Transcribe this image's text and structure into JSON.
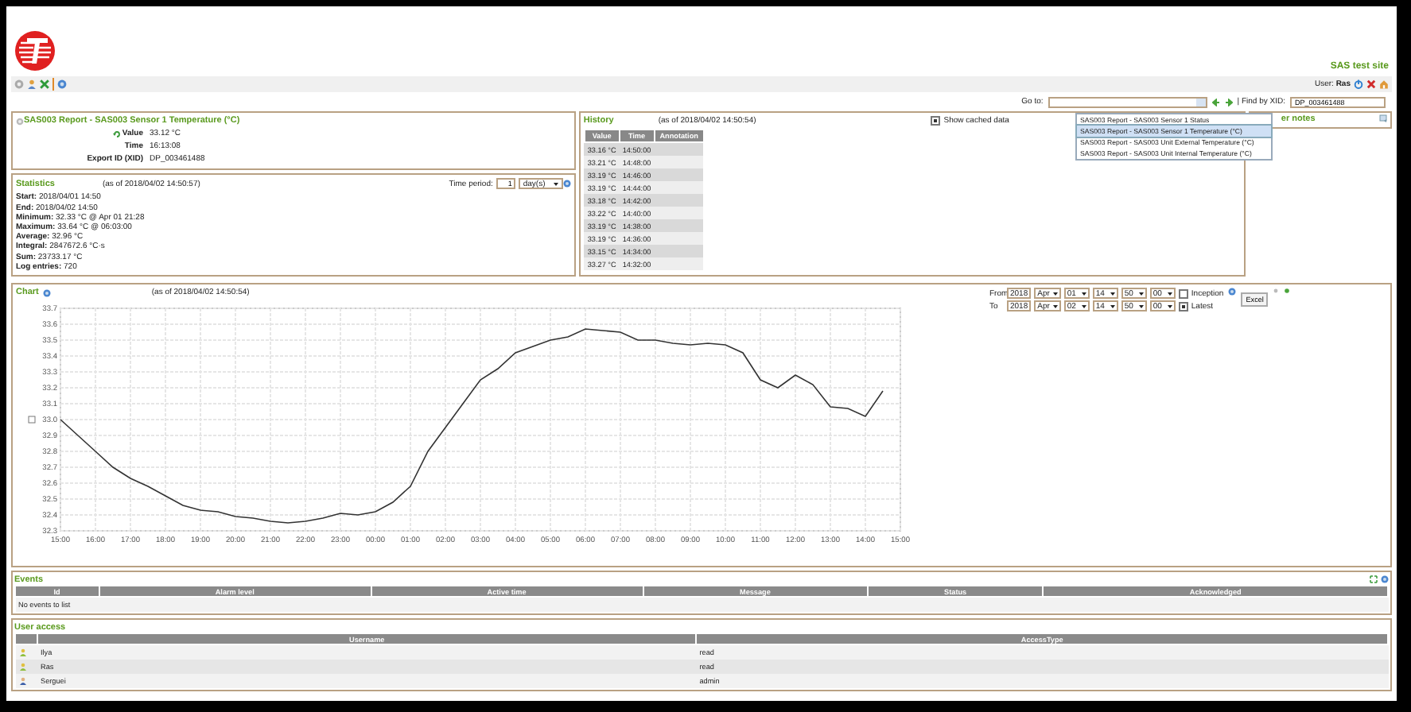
{
  "header": {
    "site_name": "SAS test site",
    "user_label": "User:",
    "user_name": "Ras"
  },
  "goto": {
    "label": "Go to:",
    "find_label": "| Find by XID:",
    "xid_value": "DP_003461488",
    "options": [
      {
        "label": "SAS003 Report - SAS003 Sensor 1 Status",
        "selected": false
      },
      {
        "label": "SAS003 Report - SAS003 Sensor 1 Temperature (°C)",
        "selected": true
      },
      {
        "label": "SAS003 Report - SAS003 Unit External Temperature (°C)",
        "selected": false
      },
      {
        "label": "SAS003 Report - SAS003 Unit Internal Temperature (°C)",
        "selected": false
      }
    ]
  },
  "point": {
    "title": "SAS003 Report - SAS003 Sensor 1 Temperature (°C)",
    "fields": [
      {
        "label": "Value",
        "value": "33.12 °C"
      },
      {
        "label": "Time",
        "value": "16:13:08"
      },
      {
        "label": "Export ID (XID)",
        "value": "DP_003461488"
      }
    ]
  },
  "statistics": {
    "title": "Statistics",
    "as_of": "(as of 2018/04/02 14:50:57)",
    "time_period_label": "Time period:",
    "period_value": "1",
    "period_unit": "day(s)",
    "lines": [
      {
        "label": "Start:",
        "value": "2018/04/01 14:50"
      },
      {
        "label": "End:",
        "value": "2018/04/02 14:50"
      },
      {
        "label": "Minimum:",
        "value": "32.33 °C @ Apr 01 21:28"
      },
      {
        "label": "Maximum:",
        "value": "33.64 °C @ 06:03:00"
      },
      {
        "label": "Average:",
        "value": "32.96 °C"
      },
      {
        "label": "Integral:",
        "value": "2847672.6 °C·s"
      },
      {
        "label": "Sum:",
        "value": "23733.17 °C"
      },
      {
        "label": "Log entries:",
        "value": "720"
      }
    ]
  },
  "history": {
    "title": "History",
    "as_of": "(as of 2018/04/02 14:50:54)",
    "show_cached": {
      "label": "Show cached data",
      "checked": true
    },
    "columns": [
      "Value",
      "Time",
      "Annotation"
    ],
    "rows": [
      {
        "value": "33.16 °C",
        "time": "14:50:00"
      },
      {
        "value": "33.21 °C",
        "time": "14:48:00"
      },
      {
        "value": "33.19 °C",
        "time": "14:46:00"
      },
      {
        "value": "33.19 °C",
        "time": "14:44:00"
      },
      {
        "value": "33.18 °C",
        "time": "14:42:00"
      },
      {
        "value": "33.22 °C",
        "time": "14:40:00"
      },
      {
        "value": "33.19 °C",
        "time": "14:38:00"
      },
      {
        "value": "33.19 °C",
        "time": "14:36:00"
      },
      {
        "value": "33.15 °C",
        "time": "14:34:00"
      },
      {
        "value": "33.27 °C",
        "time": "14:32:00"
      }
    ]
  },
  "user_notes": {
    "title": "er notes"
  },
  "chart": {
    "title": "Chart",
    "as_of": "(as of 2018/04/02 14:50:54)",
    "from": {
      "label": "From",
      "fields": [
        "2018",
        "Apr",
        "01",
        "14",
        "50",
        "00"
      ],
      "option": {
        "label": "Inception",
        "checked": false
      }
    },
    "to": {
      "label": "To",
      "fields": [
        "2018",
        "Apr",
        "02",
        "14",
        "50",
        "00"
      ],
      "option": {
        "label": "Latest",
        "checked": true
      }
    },
    "export_format": "Excel",
    "chart_data": {
      "type": "line",
      "grid": true,
      "ylim": [
        32.3,
        33.7
      ],
      "categories": [
        "15:00",
        null,
        "16:00",
        null,
        "17:00",
        null,
        "18:00",
        null,
        "19:00",
        null,
        "20:00",
        null,
        "21:00",
        null,
        "22:00",
        null,
        "23:00",
        null,
        "00:00",
        null,
        "01:00",
        null,
        "02:00",
        null,
        "03:00",
        null,
        "04:00",
        null,
        "05:00",
        null,
        "06:00",
        null,
        "07:00",
        null,
        "08:00",
        null,
        "09:00",
        null,
        "10:00",
        null,
        "11:00",
        null,
        "12:00",
        null,
        "13:00",
        null,
        "14:00",
        null,
        "15:00"
      ],
      "yticks": [
        {
          "value": 32.3,
          "label": "32.3"
        },
        {
          "value": 32.4,
          "label": "32.4"
        },
        {
          "value": 32.5,
          "label": "32.5"
        },
        {
          "value": 32.6,
          "label": "32.6"
        },
        {
          "value": 32.7,
          "label": "32.7"
        },
        {
          "value": 32.8,
          "label": "32.8"
        },
        {
          "value": 32.9,
          "label": "32.9"
        },
        {
          "value": 33.0,
          "label": "33.0"
        },
        {
          "value": 33.1,
          "label": "33.1"
        },
        {
          "value": 33.2,
          "label": "33.2"
        },
        {
          "value": 33.3,
          "label": "33.3"
        },
        {
          "value": 33.4,
          "label": "33.4"
        },
        {
          "value": 33.5,
          "label": "33.5"
        },
        {
          "value": 33.6,
          "label": "33.6"
        },
        {
          "value": 33.7,
          "label": "33.7"
        }
      ],
      "series": [
        {
          "color": "#333333",
          "values": [
            33.0,
            32.9,
            32.8,
            32.7,
            32.63,
            32.58,
            32.52,
            32.46,
            32.43,
            32.42,
            32.39,
            32.38,
            32.36,
            32.35,
            32.36,
            32.38,
            32.41,
            32.4,
            32.42,
            32.48,
            32.58,
            32.8,
            32.95,
            33.1,
            33.25,
            33.32,
            33.42,
            33.46,
            33.5,
            33.52,
            33.57,
            33.56,
            33.55,
            33.5,
            33.5,
            33.48,
            33.47,
            33.48,
            33.47,
            33.42,
            33.25,
            33.2,
            33.28,
            33.22,
            33.08,
            33.07,
            33.02,
            33.18,
            null
          ]
        }
      ]
    }
  },
  "events": {
    "title": "Events",
    "columns": [
      "Id",
      "Alarm level",
      "Active time",
      "Message",
      "Status",
      "Acknowledged"
    ],
    "empty_text": "No events to list"
  },
  "user_access": {
    "title": "User access",
    "columns": [
      "Username",
      "AccessType"
    ],
    "rows": [
      {
        "username": "Ilya",
        "access": "read",
        "kind": "user"
      },
      {
        "username": "Ras",
        "access": "read",
        "kind": "user"
      },
      {
        "username": "Serguei",
        "access": "admin",
        "kind": "admin"
      }
    ]
  }
}
